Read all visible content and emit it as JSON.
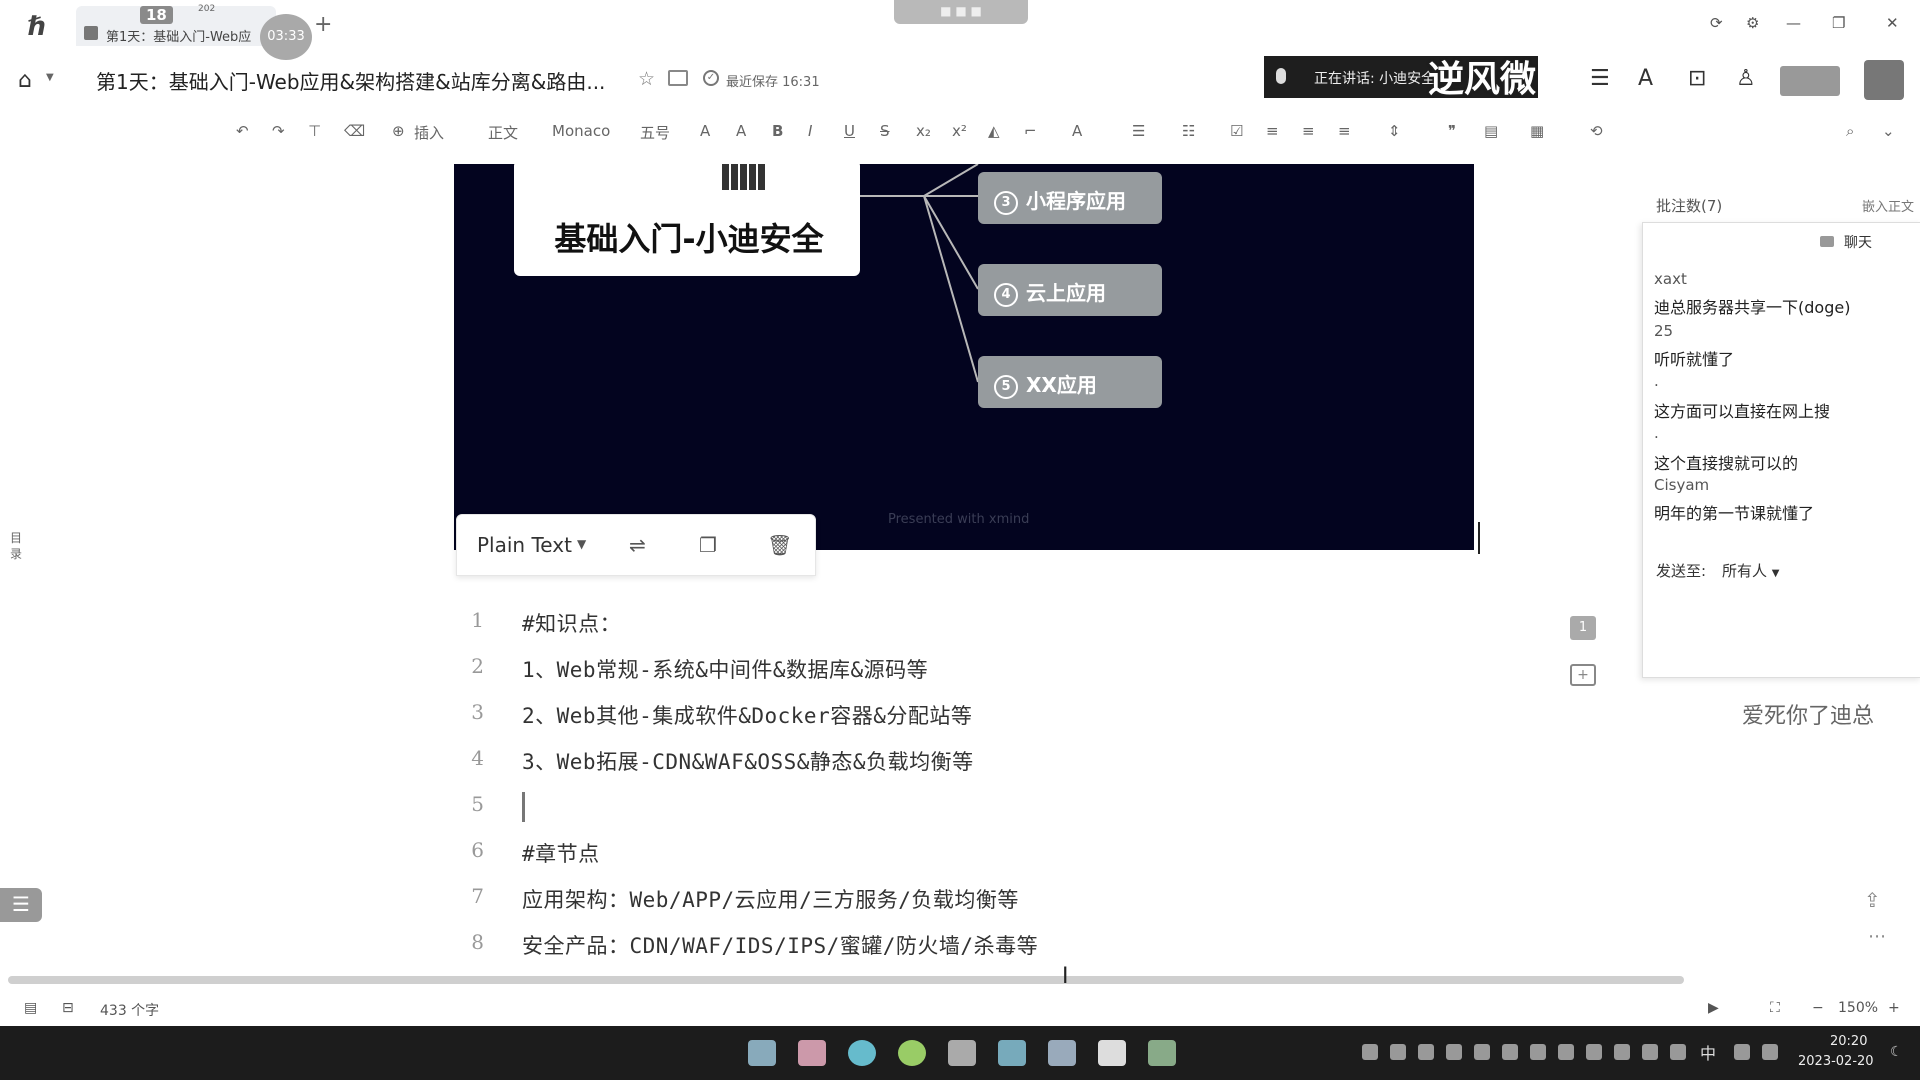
{
  "titlebar": {
    "tab_label": "第1天：基础入门-Web应",
    "tab_number": "18",
    "tab_number_small": "202",
    "recording_timer": "03:33",
    "add_tab": "+",
    "top_pill": "■ ■ ■"
  },
  "header": {
    "doc_title": "第1天：基础入门-Web应用&架构搭建&站库分离&路由...",
    "saved_status": "最近保存 16:31",
    "speaking_status": "正在讲话: 小迪安全",
    "watermark": "逆风微"
  },
  "toolbar": {
    "insert_label": "插入",
    "style_label": "正文",
    "font_label": "Monaco",
    "size_label": "五号"
  },
  "sidebar": {
    "outline_label": "目录"
  },
  "mindmap": {
    "title": "基础入门-小迪安全",
    "nodes": [
      {
        "num": "3",
        "label": "小程序应用"
      },
      {
        "num": "4",
        "label": "云上应用"
      },
      {
        "num": "5",
        "label": "XX应用"
      }
    ],
    "credit": "Presented with xmind"
  },
  "code_block": {
    "language": "Plain Text",
    "lines": [
      {
        "num": "1",
        "text": "#知识点："
      },
      {
        "num": "2",
        "text": "1、Web常规-系统&中间件&数据库&源码等"
      },
      {
        "num": "3",
        "text": "2、Web其他-集成软件&Docker容器&分配站等"
      },
      {
        "num": "4",
        "text": "3、Web拓展-CDN&WAF&OSS&静态&负载均衡等"
      },
      {
        "num": "5",
        "text": ""
      },
      {
        "num": "6",
        "text": "#章节点"
      },
      {
        "num": "7",
        "text": "应用架构：Web/APP/云应用/三方服务/负载均衡等"
      },
      {
        "num": "8",
        "text": "安全产品：CDN/WAF/IDS/IPS/蜜罐/防火墙/杀毒等"
      }
    ]
  },
  "comments": {
    "badge_count": "1",
    "header_label": "批注数(7)",
    "embed_label": "嵌入正文"
  },
  "chat": {
    "title": "聊天",
    "messages": [
      {
        "name": "xaxt",
        "text": "迪总服务器共享一下(doge)"
      },
      {
        "name": "25",
        "text": "听听就懂了"
      },
      {
        "name": ".",
        "text": "这方面可以直接在网上搜"
      },
      {
        "name": ".",
        "text": "这个直接搜就可以的"
      },
      {
        "name": "Cisyam",
        "text": "明年的第一节课就懂了"
      }
    ],
    "send_to_label": "发送至:",
    "send_to_value": "所有人",
    "floating_text": "爱死你了迪总"
  },
  "statusbar": {
    "word_count": "433 个字",
    "zoom": "150%",
    "zoom_minus": "−",
    "zoom_plus": "+"
  },
  "taskbar": {
    "ime": "中",
    "time": "20:20",
    "date": "2023-02-20"
  },
  "colors": {
    "mindmap_bg": "#03041f",
    "node_bg": "#969b9e",
    "taskbar_bg": "#1c1c1c"
  }
}
